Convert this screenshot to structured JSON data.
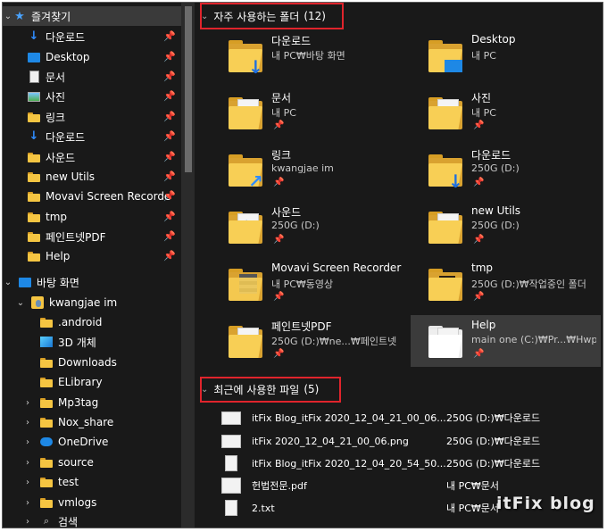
{
  "nav": {
    "quick_access": {
      "label": "즐겨찾기",
      "icon": "star-icon"
    },
    "pinned": [
      {
        "label": "다운로드",
        "icon": "download-icon"
      },
      {
        "label": "Desktop",
        "icon": "desktop-icon"
      },
      {
        "label": "문서",
        "icon": "document-icon"
      },
      {
        "label": "사진",
        "icon": "pictures-icon"
      },
      {
        "label": "링크",
        "icon": "link-icon"
      },
      {
        "label": "다운로드",
        "icon": "download-icon"
      },
      {
        "label": "사운드",
        "icon": "folder-icon"
      },
      {
        "label": "new Utils",
        "icon": "folder-icon"
      },
      {
        "label": "Movavi Screen Recorde",
        "icon": "folder-icon"
      },
      {
        "label": "tmp",
        "icon": "folder-icon"
      },
      {
        "label": "페인트넷PDF",
        "icon": "folder-icon"
      },
      {
        "label": "Help",
        "icon": "folder-icon"
      }
    ],
    "desktop": {
      "label": "바탕 화면",
      "icon": "desktop-icon"
    },
    "user": {
      "label": "kwangjae im",
      "icon": "user-folder-icon"
    },
    "user_children": [
      {
        "label": ".android",
        "icon": "folder-icon"
      },
      {
        "label": "3D 개체",
        "icon": "3d-objects-icon"
      },
      {
        "label": "Downloads",
        "icon": "folder-icon"
      },
      {
        "label": "ELibrary",
        "icon": "folder-icon"
      },
      {
        "label": "Mp3tag",
        "icon": "folder-icon"
      },
      {
        "label": "Nox_share",
        "icon": "folder-icon"
      },
      {
        "label": "OneDrive",
        "icon": "onedrive-icon"
      },
      {
        "label": "source",
        "icon": "folder-icon"
      },
      {
        "label": "test",
        "icon": "folder-icon"
      },
      {
        "label": "vmlogs",
        "icon": "folder-icon"
      },
      {
        "label": "검색",
        "icon": "search-icon"
      }
    ]
  },
  "frequent": {
    "title": "자주 사용하는 폴더",
    "count": "(12)",
    "folders": [
      {
        "name": "다운로드",
        "location": "내 PC₩바탕 화면",
        "badge": "download"
      },
      {
        "name": "Desktop",
        "location": "내 PC",
        "badge": "desktop"
      },
      {
        "name": "문서",
        "location": "내 PC",
        "badge": "document"
      },
      {
        "name": "사진",
        "location": "내 PC",
        "badge": "pictures"
      },
      {
        "name": "링크",
        "location": "kwangjae im",
        "badge": "link"
      },
      {
        "name": "다운로드",
        "location": "250G (D:)",
        "badge": "download"
      },
      {
        "name": "사운드",
        "location": "250G (D:)",
        "badge": "music"
      },
      {
        "name": "new Utils",
        "location": "250G (D:)",
        "badge": "document"
      },
      {
        "name": "Movavi Screen Recorder",
        "location": "내 PC₩동영상",
        "badge": "film"
      },
      {
        "name": "tmp",
        "location": "250G (D:)₩작업중인 폴더",
        "badge": "dark"
      },
      {
        "name": "페인트넷PDF",
        "location": "250G (D:)₩ne...₩페인트넷",
        "badge": "paint"
      },
      {
        "name": "Help",
        "location": "main one (C:)₩Pr...₩Hwp",
        "badge": "document"
      }
    ]
  },
  "recent": {
    "title": "최근에 사용한 파일",
    "count": "(5)",
    "files": [
      {
        "name": "itFix Blog_itFix 2020_12_04_21_00_06....",
        "location": "250G (D:)₩다운로드"
      },
      {
        "name": "itFix 2020_12_04_21_00_06.png",
        "location": "250G (D:)₩다운로드"
      },
      {
        "name": "itFix Blog_itFix 2020_12_04_20_54_50....",
        "location": "250G (D:)₩다운로드"
      },
      {
        "name": "헌법전문.pdf",
        "location": "내 PC₩문서"
      },
      {
        "name": "2.txt",
        "location": "내 PC₩문서"
      }
    ]
  },
  "watermark": "itFix blog",
  "colors": {
    "background": "#191919",
    "highlight": "#e0242c",
    "selected": "#3b3b3b"
  }
}
